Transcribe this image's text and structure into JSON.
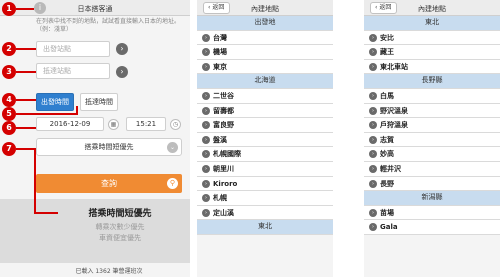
{
  "panel1": {
    "title": "日本搭客通",
    "info_glyph": "i",
    "note": "在列表中找不到的地點，試試看直接輸入日本的地址。（例：淺草）",
    "departure_placeholder": "出發站點",
    "arrival_placeholder": "抵達站點",
    "arrow_glyph": "›",
    "tab_departure": "出發時間",
    "tab_arrival": "抵達時間",
    "date_value": "2016-12-09",
    "time_value": "15:21",
    "calendar_glyph": "▦",
    "clock_glyph": "◷",
    "sort_select": "搭乘時間短優先",
    "chevron_glyph": "⌄",
    "search_label": "查詢",
    "search_glyph": "⚲",
    "dropdown_selected": "搭乘時間短優先",
    "dropdown_options": [
      "轉乘次數少優先",
      "車資便宜優先"
    ],
    "footer": "已載入 1362 筆營運班次"
  },
  "annotations": [
    "1",
    "2",
    "3",
    "4",
    "5",
    "6",
    "7"
  ],
  "colors": {
    "accent_blue": "#2f7fcf",
    "search_orange": "#f08b33",
    "section_blue": "#c8dcef",
    "annotation_red": "#d40000"
  },
  "list2": {
    "back_label": "返回",
    "title": "內建地點",
    "rows": [
      {
        "type": "section",
        "label": "出發地"
      },
      {
        "type": "item",
        "label": "台灣"
      },
      {
        "type": "item",
        "label": "機場"
      },
      {
        "type": "item",
        "label": "東京"
      },
      {
        "type": "section",
        "label": "北海道"
      },
      {
        "type": "item",
        "label": "二世谷"
      },
      {
        "type": "item",
        "label": "留壽都"
      },
      {
        "type": "item",
        "label": "富良野"
      },
      {
        "type": "item",
        "label": "盤溪"
      },
      {
        "type": "item",
        "label": "札幌國際"
      },
      {
        "type": "item",
        "label": "朝里川"
      },
      {
        "type": "item",
        "label": "Kiroro"
      },
      {
        "type": "item",
        "label": "札幌"
      },
      {
        "type": "item",
        "label": "定山溪"
      },
      {
        "type": "section",
        "label": "東北"
      }
    ]
  },
  "list3": {
    "back_label": "返回",
    "title": "內建地點",
    "rows": [
      {
        "type": "section",
        "label": "東北"
      },
      {
        "type": "item",
        "label": "安比"
      },
      {
        "type": "item",
        "label": "藏王"
      },
      {
        "type": "item",
        "label": "東北車站"
      },
      {
        "type": "section",
        "label": "長野縣"
      },
      {
        "type": "item",
        "label": "白馬"
      },
      {
        "type": "item",
        "label": "野沢溫泉"
      },
      {
        "type": "item",
        "label": "戶狩溫泉"
      },
      {
        "type": "item",
        "label": "志賀"
      },
      {
        "type": "item",
        "label": "妙高"
      },
      {
        "type": "item",
        "label": "輕井沢"
      },
      {
        "type": "item",
        "label": "長野"
      },
      {
        "type": "section",
        "label": "新潟縣"
      },
      {
        "type": "item",
        "label": "苗場"
      },
      {
        "type": "item",
        "label": "Gala"
      }
    ]
  },
  "list_item_glyph": "›"
}
